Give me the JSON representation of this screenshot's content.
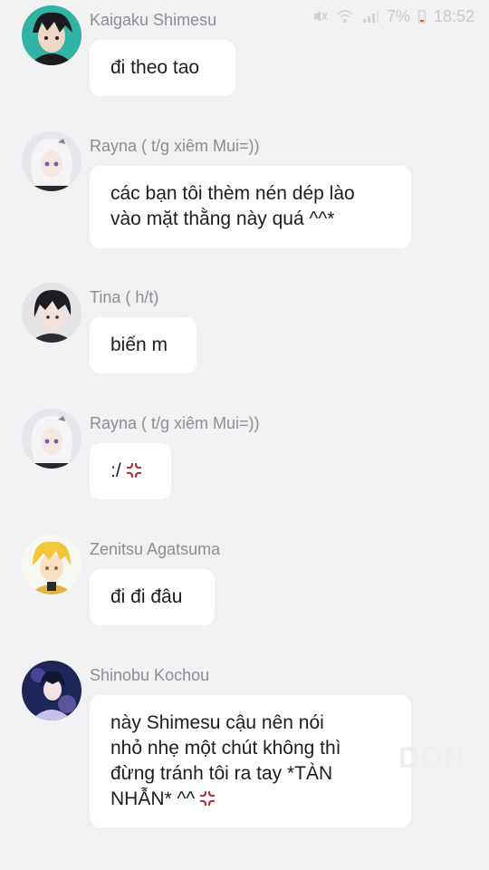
{
  "status_bar": {
    "mute_icon": "mute-icon",
    "wifi_icon": "wifi-icon",
    "signal_icon": "signal-icon",
    "battery_percent": "7%",
    "time": "18:52"
  },
  "messages": [
    {
      "sender": "Kaigaku Shimesu",
      "text": "đi theo tao",
      "emoji": ""
    },
    {
      "sender": "Rayna ( t/g xiêm Mui=))",
      "text": "các bạn tôi thèm nén dép lào\nvào mặt thằng này quá ^^*",
      "emoji": ""
    },
    {
      "sender": "Tina ( h/t)",
      "text": "biến m",
      "emoji": ""
    },
    {
      "sender": "Rayna ( t/g xiêm Mui=))",
      "text": ":/",
      "emoji": "anger-symbol-icon"
    },
    {
      "sender": "Zenitsu Agatsuma",
      "text": "đi đi đâu",
      "emoji": ""
    },
    {
      "sender": "Shinobu Kochou",
      "text": "này Shimesu cậu nên nói\nnhỏ nhẹ một chút không thì\nđừng tránh tôi ra tay *TÀN\nNHẪN* ^^",
      "emoji": "anger-symbol-icon"
    }
  ],
  "watermark": "DON",
  "colors": {
    "background": "#f1f1f3",
    "bubble": "#ffffff",
    "name": "#8e8e93",
    "text": "#1d1d1f",
    "anger": "#b0343a"
  }
}
